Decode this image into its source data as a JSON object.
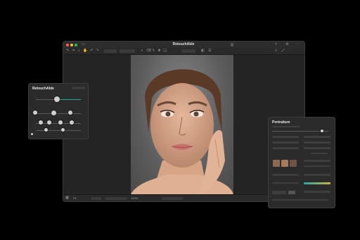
{
  "main_window": {
    "title": "RetouchAble",
    "status": {
      "left": "Fit",
      "center": "100%"
    }
  },
  "retouch_panel": {
    "title": "RetouchAble"
  },
  "portraiture_panel": {
    "title": "Portraiture"
  },
  "colors": {
    "accent": "#2aa6a0",
    "background": "#000000",
    "window": "#262626",
    "close": "#ff5f57",
    "minimize": "#febc2e",
    "zoom": "#28c840"
  },
  "icons": [
    "close-icon",
    "minimize-icon",
    "zoom-icon",
    "brush-icon",
    "crop-icon",
    "zoom-tool-icon",
    "hand-icon",
    "undo-icon",
    "redo-icon",
    "share-icon",
    "settings-icon"
  ]
}
